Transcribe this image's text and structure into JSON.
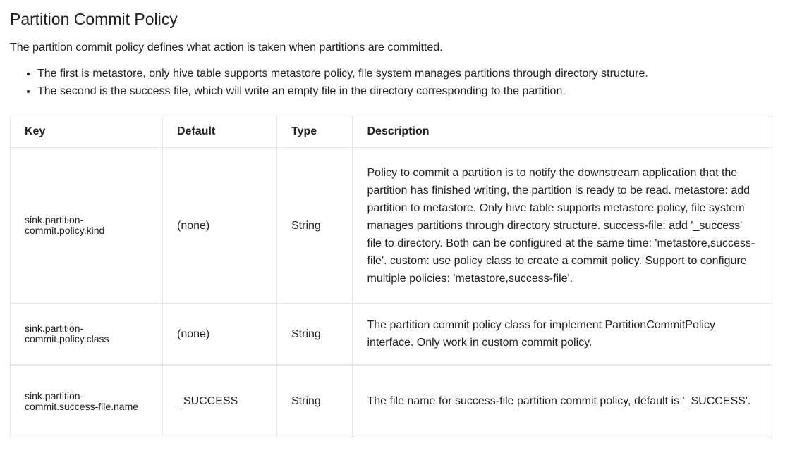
{
  "section": {
    "title": "Partition Commit Policy",
    "intro": "The partition commit policy defines what action is taken when partitions are committed.",
    "bullets": [
      "The first is metastore, only hive table supports metastore policy, file system manages partitions through directory structure.",
      "The second is the success file, which will write an empty file in the directory corresponding to the partition."
    ]
  },
  "table": {
    "headers": {
      "key": "Key",
      "default": "Default",
      "type": "Type",
      "description": "Description"
    },
    "rows": [
      {
        "key": "sink.partition-commit.policy.kind",
        "default": "(none)",
        "type": "String",
        "description": "Policy to commit a partition is to notify the downstream application that the partition has finished writing, the partition is ready to be read. metastore: add partition to metastore. Only hive table supports metastore policy, file system manages partitions through directory structure. success-file: add '_success' file to directory. Both can be configured at the same time: 'metastore,success-file'. custom: use policy class to create a commit policy. Support to configure multiple policies: 'metastore,success-file'."
      },
      {
        "key": "sink.partition-commit.policy.class",
        "default": "(none)",
        "type": "String",
        "description": "The partition commit policy class for implement PartitionCommitPolicy interface. Only work in custom commit policy."
      },
      {
        "key": "sink.partition-commit.success-file.name",
        "default": "_SUCCESS",
        "type": "String",
        "description": "The file name for success-file partition commit policy, default is '_SUCCESS'."
      }
    ]
  }
}
